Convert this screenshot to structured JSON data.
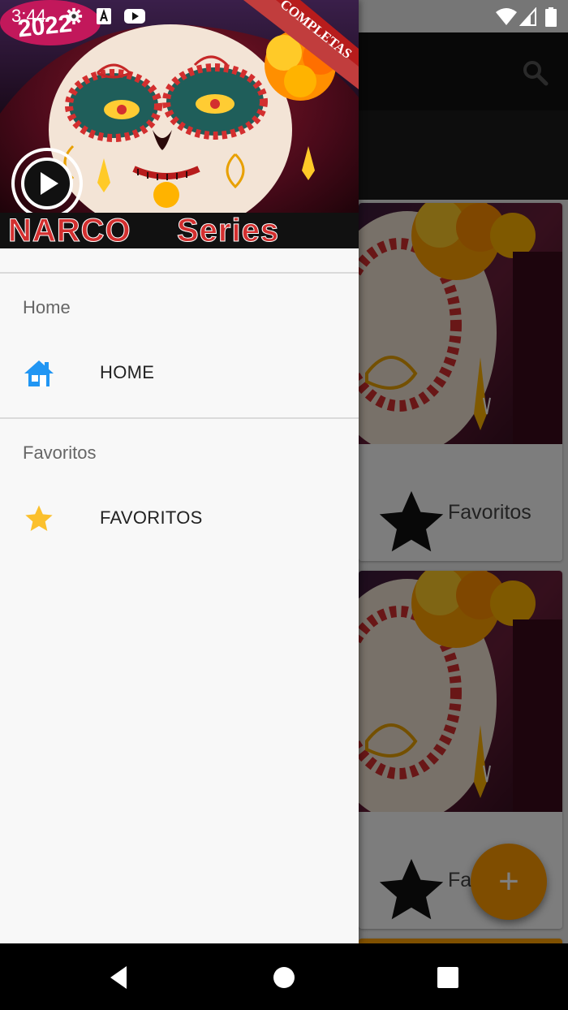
{
  "status_bar": {
    "time": "3:44",
    "icons": [
      "settings-icon",
      "accessibility-a-icon",
      "youtube-icon",
      "wifi-icon",
      "signal-icon",
      "battery-icon"
    ]
  },
  "drawer": {
    "header_image": {
      "title_left": "NARCO",
      "title_right": "Series",
      "ribbon": "COMPLETAS",
      "badge": "2022"
    },
    "sections": [
      {
        "title": "Home",
        "item_label": "HOME",
        "icon": "home-icon"
      },
      {
        "title": "Favoritos",
        "item_label": "FAVORITOS",
        "icon": "star-icon"
      }
    ]
  },
  "background_app": {
    "cards": [
      {
        "label": "Favoritos",
        "icon": "star-icon"
      },
      {
        "label": "Fa",
        "icon": "star-icon"
      }
    ],
    "fab_label": "+"
  },
  "colors": {
    "drawer_bg": "#f8f8f8",
    "home_icon": "#2196f3",
    "star_icon": "#fbc02d",
    "fab": "#ff9a00",
    "toolbar": "#111111"
  }
}
